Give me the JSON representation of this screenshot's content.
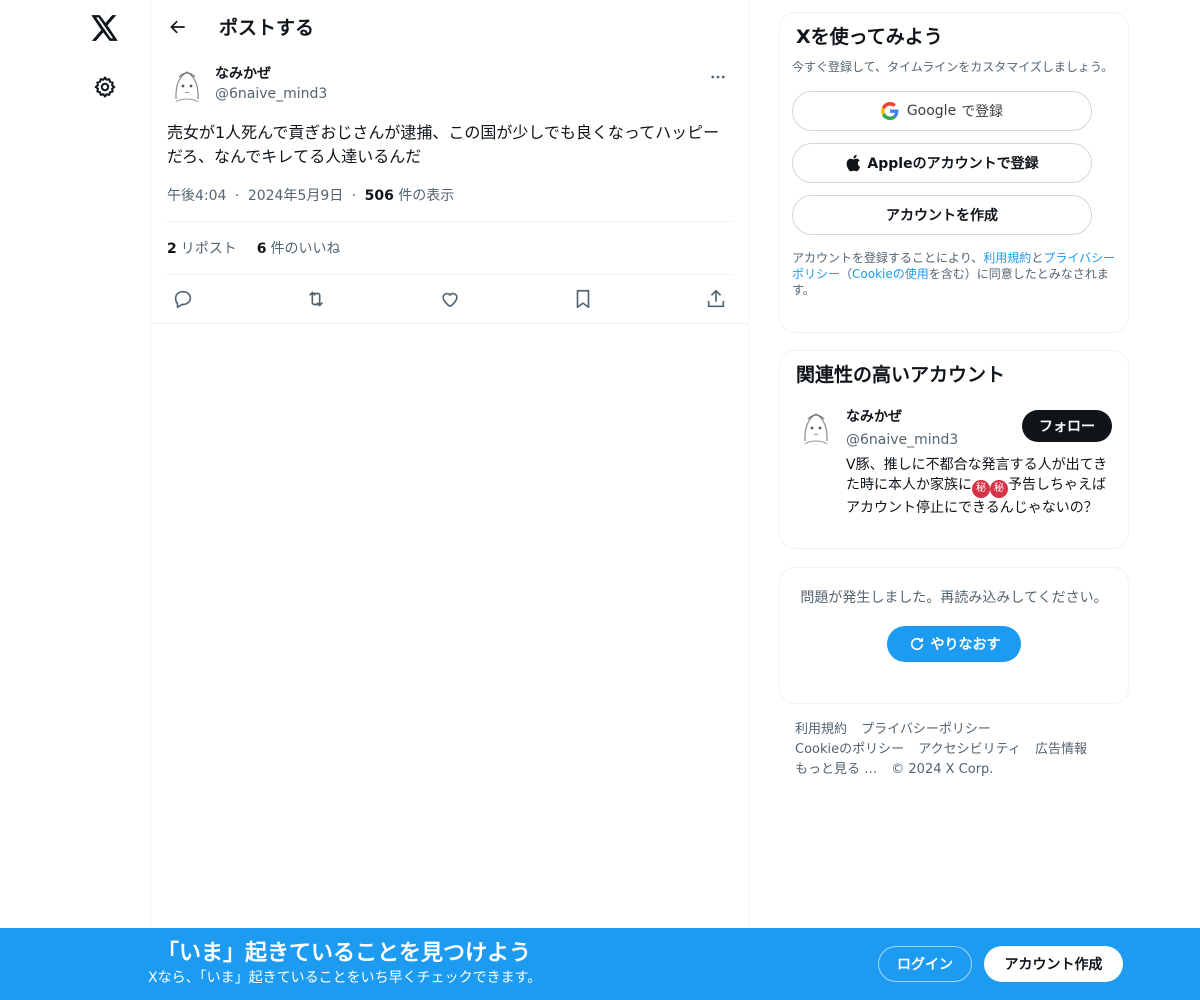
{
  "colors": {
    "accent": "#1d9bf0",
    "text": "#0f1419",
    "muted": "#536471",
    "border": "#eff3f4"
  },
  "nav": {
    "logo_icon": "x-logo-icon",
    "settings_icon": "gear-icon"
  },
  "header": {
    "title": "ポストする",
    "back_icon": "arrow-left-icon"
  },
  "post": {
    "author_name": "なみかぜ",
    "author_handle": "@6naive_mind3",
    "text": "売女が1人死んで貢ぎおじさんが逮捕、この国が少しでも良くなってハッピーだろ、なんでキレてる人達いるんだ",
    "time": "午後4:04",
    "dot1": "·",
    "date": "2024年5月9日",
    "dot2": "·",
    "views_count": "506",
    "views_label": "件の表示",
    "reposts_count": "2",
    "reposts_label": "リポスト",
    "likes_count": "6",
    "likes_label": "件のいいね"
  },
  "signup": {
    "title": "Xを使ってみよう",
    "subtitle": "今すぐ登録して、タイムラインをカスタマイズしましょう。",
    "google_label_a": "Google",
    "google_label_b": "で登録",
    "apple_label": "Appleのアカウントで登録",
    "create_label": "アカウントを作成",
    "legal_1": "アカウントを登録することにより、",
    "legal_terms": "利用規約",
    "legal_2": "と",
    "legal_privacy": "プライバシーポリシー",
    "legal_3": "（",
    "legal_cookie": "Cookieの使用",
    "legal_4": "を含む）に同意したとみなされます。"
  },
  "related": {
    "title": "関連性の高いアカウント",
    "name": "なみかぜ",
    "handle": "@6naive_mind3",
    "follow_label": "フォロー",
    "bio_1": "V豚、推しに不都合な発言する人が出てきた時に本人か家族に",
    "bio_secret": "㊙",
    "bio_2": "予告しちゃえばアカウント停止にできるんじゃないの？"
  },
  "error": {
    "text": "問題が発生しました。再読み込みしてください。",
    "retry_label": "やりなおす"
  },
  "footer": {
    "terms": "利用規約",
    "privacy": "プライバシーポリシー",
    "cookie": "Cookieのポリシー",
    "accessibility": "アクセシビリティ",
    "ads": "広告情報",
    "more": "もっと見る …",
    "copyright": "© 2024 X Corp."
  },
  "banner": {
    "title": "「いま」起きていることを見つけよう",
    "subtitle": "Xなら、「いま」起きていることをいち早くチェックできます。",
    "login_label": "ログイン",
    "create_label": "アカウント作成"
  }
}
